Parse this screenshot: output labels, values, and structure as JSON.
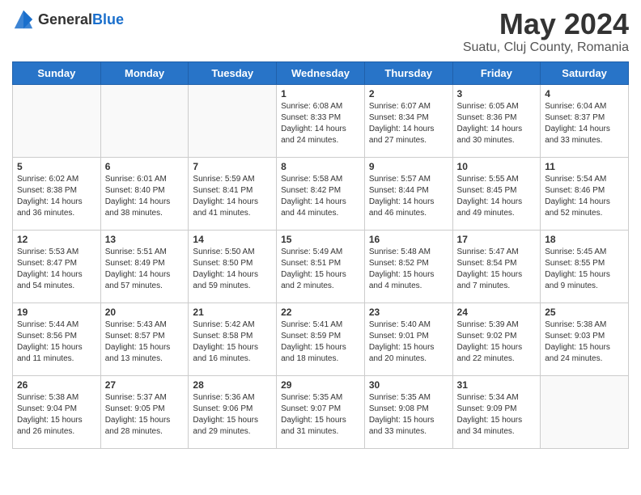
{
  "header": {
    "logo_general": "General",
    "logo_blue": "Blue",
    "main_title": "May 2024",
    "subtitle": "Suatu, Cluj County, Romania"
  },
  "days_of_week": [
    "Sunday",
    "Monday",
    "Tuesday",
    "Wednesday",
    "Thursday",
    "Friday",
    "Saturday"
  ],
  "weeks": [
    [
      {
        "day": "",
        "info": ""
      },
      {
        "day": "",
        "info": ""
      },
      {
        "day": "",
        "info": ""
      },
      {
        "day": "1",
        "info": "Sunrise: 6:08 AM\nSunset: 8:33 PM\nDaylight: 14 hours\nand 24 minutes."
      },
      {
        "day": "2",
        "info": "Sunrise: 6:07 AM\nSunset: 8:34 PM\nDaylight: 14 hours\nand 27 minutes."
      },
      {
        "day": "3",
        "info": "Sunrise: 6:05 AM\nSunset: 8:36 PM\nDaylight: 14 hours\nand 30 minutes."
      },
      {
        "day": "4",
        "info": "Sunrise: 6:04 AM\nSunset: 8:37 PM\nDaylight: 14 hours\nand 33 minutes."
      }
    ],
    [
      {
        "day": "5",
        "info": "Sunrise: 6:02 AM\nSunset: 8:38 PM\nDaylight: 14 hours\nand 36 minutes."
      },
      {
        "day": "6",
        "info": "Sunrise: 6:01 AM\nSunset: 8:40 PM\nDaylight: 14 hours\nand 38 minutes."
      },
      {
        "day": "7",
        "info": "Sunrise: 5:59 AM\nSunset: 8:41 PM\nDaylight: 14 hours\nand 41 minutes."
      },
      {
        "day": "8",
        "info": "Sunrise: 5:58 AM\nSunset: 8:42 PM\nDaylight: 14 hours\nand 44 minutes."
      },
      {
        "day": "9",
        "info": "Sunrise: 5:57 AM\nSunset: 8:44 PM\nDaylight: 14 hours\nand 46 minutes."
      },
      {
        "day": "10",
        "info": "Sunrise: 5:55 AM\nSunset: 8:45 PM\nDaylight: 14 hours\nand 49 minutes."
      },
      {
        "day": "11",
        "info": "Sunrise: 5:54 AM\nSunset: 8:46 PM\nDaylight: 14 hours\nand 52 minutes."
      }
    ],
    [
      {
        "day": "12",
        "info": "Sunrise: 5:53 AM\nSunset: 8:47 PM\nDaylight: 14 hours\nand 54 minutes."
      },
      {
        "day": "13",
        "info": "Sunrise: 5:51 AM\nSunset: 8:49 PM\nDaylight: 14 hours\nand 57 minutes."
      },
      {
        "day": "14",
        "info": "Sunrise: 5:50 AM\nSunset: 8:50 PM\nDaylight: 14 hours\nand 59 minutes."
      },
      {
        "day": "15",
        "info": "Sunrise: 5:49 AM\nSunset: 8:51 PM\nDaylight: 15 hours\nand 2 minutes."
      },
      {
        "day": "16",
        "info": "Sunrise: 5:48 AM\nSunset: 8:52 PM\nDaylight: 15 hours\nand 4 minutes."
      },
      {
        "day": "17",
        "info": "Sunrise: 5:47 AM\nSunset: 8:54 PM\nDaylight: 15 hours\nand 7 minutes."
      },
      {
        "day": "18",
        "info": "Sunrise: 5:45 AM\nSunset: 8:55 PM\nDaylight: 15 hours\nand 9 minutes."
      }
    ],
    [
      {
        "day": "19",
        "info": "Sunrise: 5:44 AM\nSunset: 8:56 PM\nDaylight: 15 hours\nand 11 minutes."
      },
      {
        "day": "20",
        "info": "Sunrise: 5:43 AM\nSunset: 8:57 PM\nDaylight: 15 hours\nand 13 minutes."
      },
      {
        "day": "21",
        "info": "Sunrise: 5:42 AM\nSunset: 8:58 PM\nDaylight: 15 hours\nand 16 minutes."
      },
      {
        "day": "22",
        "info": "Sunrise: 5:41 AM\nSunset: 8:59 PM\nDaylight: 15 hours\nand 18 minutes."
      },
      {
        "day": "23",
        "info": "Sunrise: 5:40 AM\nSunset: 9:01 PM\nDaylight: 15 hours\nand 20 minutes."
      },
      {
        "day": "24",
        "info": "Sunrise: 5:39 AM\nSunset: 9:02 PM\nDaylight: 15 hours\nand 22 minutes."
      },
      {
        "day": "25",
        "info": "Sunrise: 5:38 AM\nSunset: 9:03 PM\nDaylight: 15 hours\nand 24 minutes."
      }
    ],
    [
      {
        "day": "26",
        "info": "Sunrise: 5:38 AM\nSunset: 9:04 PM\nDaylight: 15 hours\nand 26 minutes."
      },
      {
        "day": "27",
        "info": "Sunrise: 5:37 AM\nSunset: 9:05 PM\nDaylight: 15 hours\nand 28 minutes."
      },
      {
        "day": "28",
        "info": "Sunrise: 5:36 AM\nSunset: 9:06 PM\nDaylight: 15 hours\nand 29 minutes."
      },
      {
        "day": "29",
        "info": "Sunrise: 5:35 AM\nSunset: 9:07 PM\nDaylight: 15 hours\nand 31 minutes."
      },
      {
        "day": "30",
        "info": "Sunrise: 5:35 AM\nSunset: 9:08 PM\nDaylight: 15 hours\nand 33 minutes."
      },
      {
        "day": "31",
        "info": "Sunrise: 5:34 AM\nSunset: 9:09 PM\nDaylight: 15 hours\nand 34 minutes."
      },
      {
        "day": "",
        "info": ""
      }
    ]
  ]
}
